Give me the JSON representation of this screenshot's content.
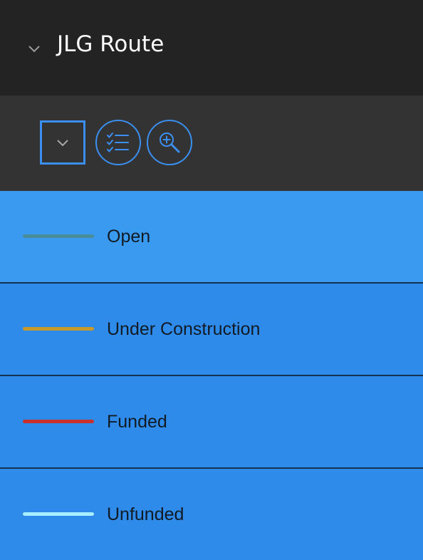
{
  "header": {
    "title": "JLG Route",
    "collapse_icon": "chevron-down-icon"
  },
  "toolbar": {
    "buttons": [
      {
        "name": "layer-options-button",
        "icon": "chevron-down-icon"
      },
      {
        "name": "legend-list-button",
        "icon": "checklist-icon"
      },
      {
        "name": "zoom-to-layer-button",
        "icon": "zoom-in-icon"
      }
    ]
  },
  "legend": {
    "items": [
      {
        "label": "Open",
        "color": "#4a8d9a"
      },
      {
        "label": "Under Construction",
        "color": "#c99a2a"
      },
      {
        "label": "Funded",
        "color": "#c9302c"
      },
      {
        "label": "Unfunded",
        "color": "#a8ecff"
      }
    ]
  },
  "colors": {
    "header_bg": "#232323",
    "toolbar_bg": "#333333",
    "accent": "#3a8ff0",
    "row_highlight": "#3a9af0",
    "row_bg": "#2e8bea"
  }
}
